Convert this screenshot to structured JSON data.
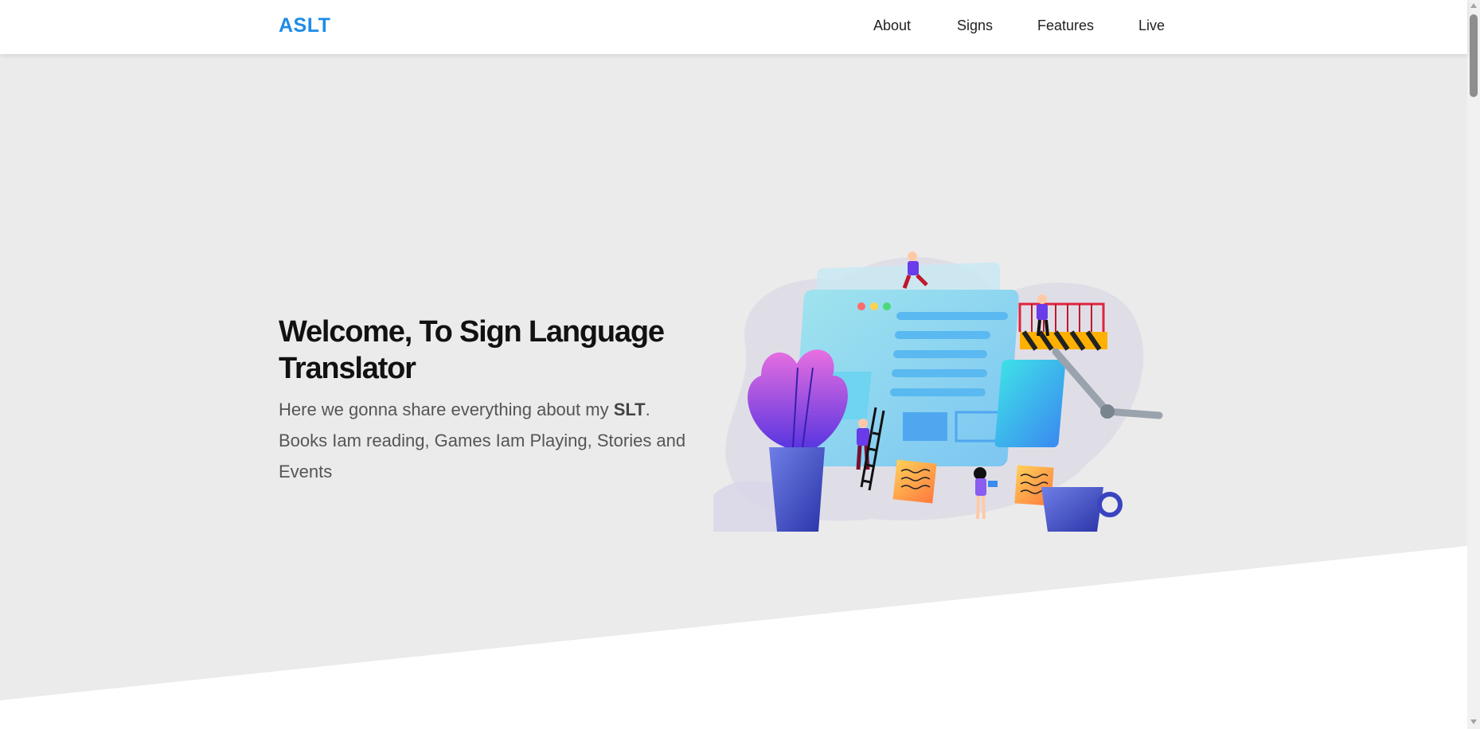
{
  "navbar": {
    "brand": "ASLT",
    "links": [
      {
        "label": "About"
      },
      {
        "label": "Signs"
      },
      {
        "label": "Features"
      },
      {
        "label": "Live"
      }
    ]
  },
  "hero": {
    "title": "Welcome, To Sign Language Translator",
    "description": {
      "before": "Here we gonna share everything about my ",
      "highlight": "SLT",
      "after": ". Books Iam reading, Games Iam Playing, Stories and Events"
    }
  },
  "colors": {
    "brand": "#1e8ce8",
    "hero_background": "#ebebeb",
    "page_background": "#ffffff",
    "scroll_icon": "#1e8ce8"
  },
  "icons": {
    "scroll_down": "chevron-double-down-icon"
  }
}
